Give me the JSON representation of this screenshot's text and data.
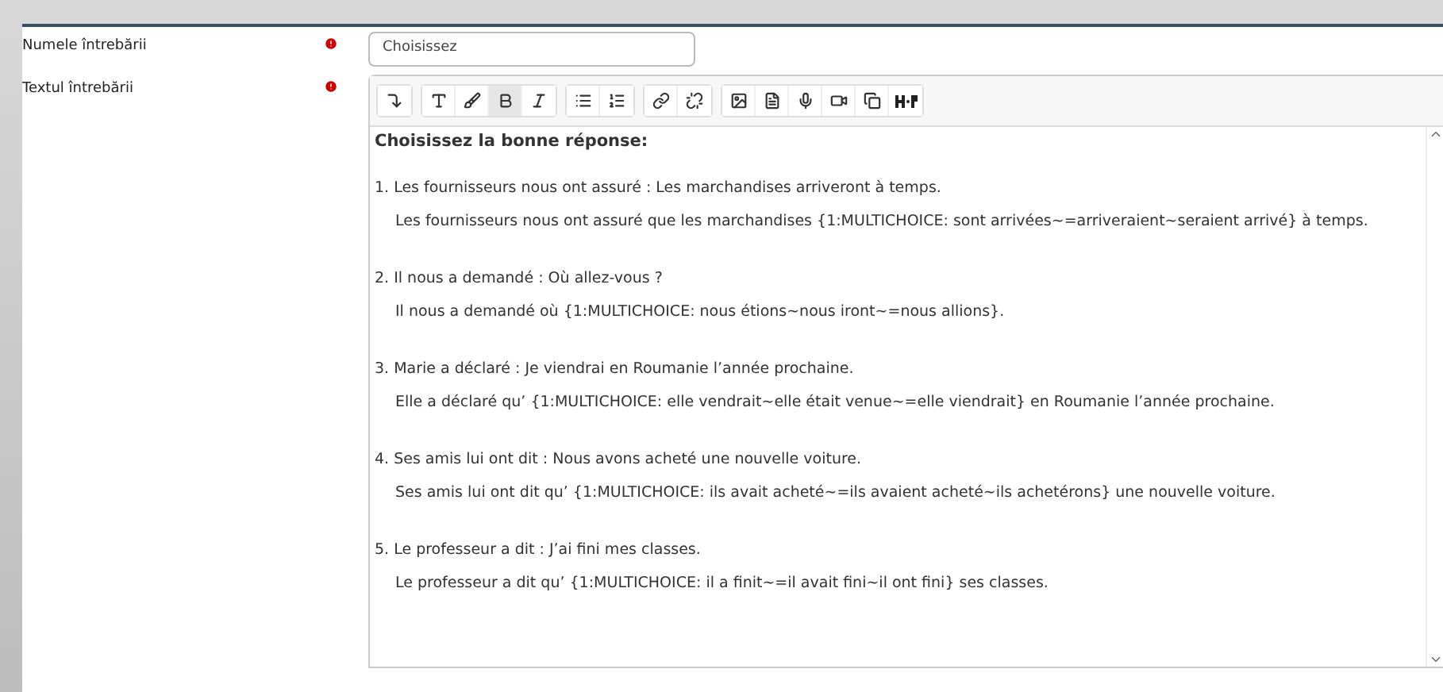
{
  "fields": [
    {
      "label": "Numele întrebării",
      "required": true,
      "kind": "input",
      "value": "Choisissez"
    },
    {
      "label": "Textul întrebării",
      "required": true,
      "kind": "editor"
    }
  ],
  "toolbar": [
    [
      {
        "kind": "collapse",
        "active": false
      }
    ],
    [
      {
        "kind": "font",
        "active": false
      },
      {
        "kind": "brush",
        "active": false
      },
      {
        "kind": "bold",
        "active": true
      },
      {
        "kind": "italic",
        "active": false
      }
    ],
    [
      {
        "kind": "bullets",
        "active": false
      },
      {
        "kind": "numbers",
        "active": false
      }
    ],
    [
      {
        "kind": "link",
        "active": false
      },
      {
        "kind": "unlink",
        "active": false
      }
    ],
    [
      {
        "kind": "image",
        "active": false
      },
      {
        "kind": "file",
        "active": false
      },
      {
        "kind": "mic",
        "active": false
      },
      {
        "kind": "video",
        "active": false
      },
      {
        "kind": "copy",
        "active": false
      },
      {
        "kind": "h5p",
        "active": false
      }
    ]
  ],
  "content": [
    {
      "kind": "heading",
      "text": "Choisissez la bonne réponse:"
    },
    {
      "kind": "item",
      "text": "1. Les fournisseurs nous ont assuré : Les marchandises arriveront à temps."
    },
    {
      "kind": "answer",
      "text": "Les fournisseurs nous ont assuré que les marchandises {1:MULTICHOICE: sont arrivées~=arriveraient~seraient arrivé} à temps."
    },
    {
      "kind": "item",
      "text": "2. Il nous a demandé : Où allez-vous ?"
    },
    {
      "kind": "answer",
      "text": "Il nous a demandé où {1:MULTICHOICE: nous étions~nous iront~=nous allions}."
    },
    {
      "kind": "item",
      "text": "3. Marie a déclaré : Je viendrai en Roumanie l’année prochaine."
    },
    {
      "kind": "answer",
      "text": "Elle a déclaré qu’ {1:MULTICHOICE: elle vendrait~elle était venue~=elle viendrait} en Roumanie l’année prochaine."
    },
    {
      "kind": "item",
      "text": "4. Ses amis lui ont dit : Nous avons acheté une nouvelle voiture."
    },
    {
      "kind": "answer",
      "text": "Ses amis lui ont dit qu’ {1:MULTICHOICE: ils avait acheté~=ils avaient acheté~ils achetérons} une nouvelle voiture."
    },
    {
      "kind": "item",
      "text": "5. Le professeur a dit : J’ai fini mes classes."
    },
    {
      "kind": "answer",
      "text": "Le professeur a dit qu’ {1:MULTICHOICE: il a finit~=il avait fini~il ont fini} ses classes."
    }
  ]
}
